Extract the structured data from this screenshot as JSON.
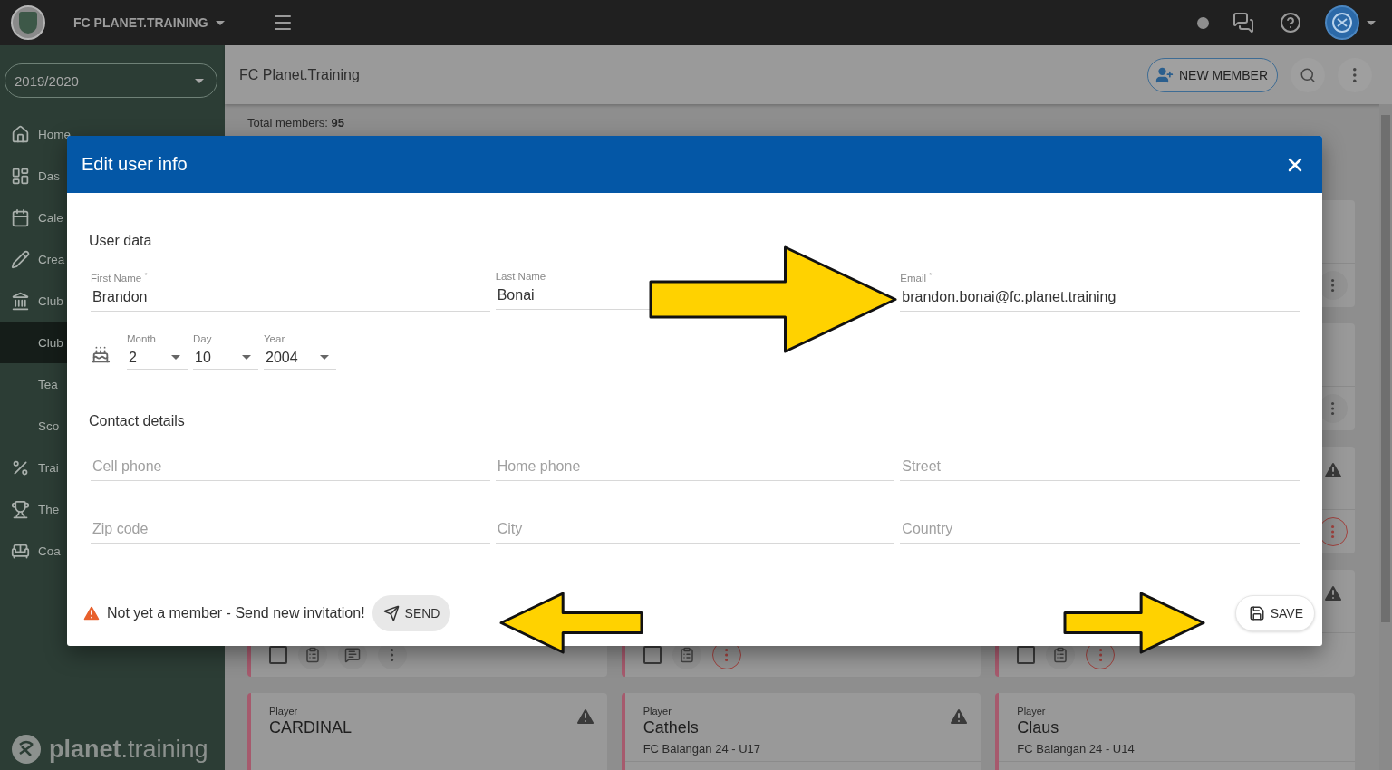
{
  "top_bar": {
    "club_name": "FC PLANET.TRAINING"
  },
  "sidebar": {
    "season": "2019/2020",
    "items": [
      {
        "label": "Home",
        "selected": false
      },
      {
        "label": "Das",
        "selected": false
      },
      {
        "label": "Cale",
        "selected": false
      },
      {
        "label": "Crea",
        "selected": false
      },
      {
        "label": "Club",
        "selected": false,
        "children": [
          {
            "label": "Club",
            "selected": true
          },
          {
            "label": "Tea",
            "selected": false
          },
          {
            "label": "Sco",
            "selected": false
          }
        ]
      },
      {
        "label": "Trai",
        "selected": false
      },
      {
        "label": "The",
        "selected": false
      },
      {
        "label": "Coa",
        "selected": false
      }
    ],
    "brand": "**planet**.training"
  },
  "page_header": {
    "title": "FC Planet.Training",
    "new_member_button": "NEW MEMBER"
  },
  "summary": "Total members: **95**",
  "card_rows": [
    {
      "cards": [
        {
          "warning": false,
          "actions": {
            "alert": false
          }
        }
      ]
    },
    {
      "cards": [
        {
          "warning": false,
          "actions": {
            "alert": false
          }
        }
      ]
    },
    {
      "cards": [
        {
          "warning": true,
          "actions": {
            "alert": true
          }
        }
      ]
    },
    {
      "cards": [
        {
          "warning": false,
          "actions": {
            "alert": false,
            "tools": [
              {
                "kind": "checkbox",
                "checked": false
              },
              {
                "kind": "clipboard"
              },
              {
                "kind": "chat"
              }
            ]
          }
        },
        {
          "warning": false,
          "actions": {
            "alert": true,
            "tools": [
              {
                "kind": "checkbox",
                "checked": false
              },
              {
                "kind": "clipboard"
              }
            ]
          }
        },
        {
          "warning": true,
          "actions": {
            "alert": true,
            "tools": [
              {
                "kind": "checkbox",
                "checked": false
              },
              {
                "kind": "clipboard"
              }
            ]
          }
        }
      ]
    },
    {
      "cards": [
        {
          "role": "Player",
          "name": "CARDINAL",
          "warning": true
        },
        {
          "role": "Player",
          "name": "Cathels",
          "team": "FC Balangan 24 - U17",
          "warning": true
        },
        {
          "role": "Player",
          "name": "Claus",
          "team": "FC Balangan 24 - U14",
          "warning": false
        }
      ]
    }
  ],
  "dialog": {
    "title": "Edit user info",
    "user_data": {
      "title": "User data",
      "fields": [
        {
          "label": "First Name $^{*}$",
          "value": "Brandon"
        },
        {
          "label": "Last Name",
          "value": "Bonai"
        },
        {
          "label": "Email $^{*}$",
          "value": "brandon.bonai@fc.planet.training"
        }
      ],
      "birthday": [
        {
          "label": "Month",
          "value": "2"
        },
        {
          "label": "Day",
          "value": "10"
        },
        {
          "label": "Year",
          "value": "2004"
        }
      ]
    },
    "contact": {
      "title": "Contact details",
      "fields": [
        {
          "placeholder": "Cell phone"
        },
        {
          "placeholder": "Home phone"
        },
        {
          "placeholder": "Street"
        },
        {
          "placeholder": "Zip code"
        },
        {
          "placeholder": "City"
        },
        {
          "placeholder": "Country"
        }
      ]
    },
    "notice": "Not yet a member - Send new invitation!",
    "send_button": "SEND",
    "save_button": "SAVE"
  },
  "annotations": [
    {
      "kind": "rightarrow"
    },
    {
      "kind": "leftarrow"
    },
    {
      "kind": "rightarrow"
    }
  ]
}
